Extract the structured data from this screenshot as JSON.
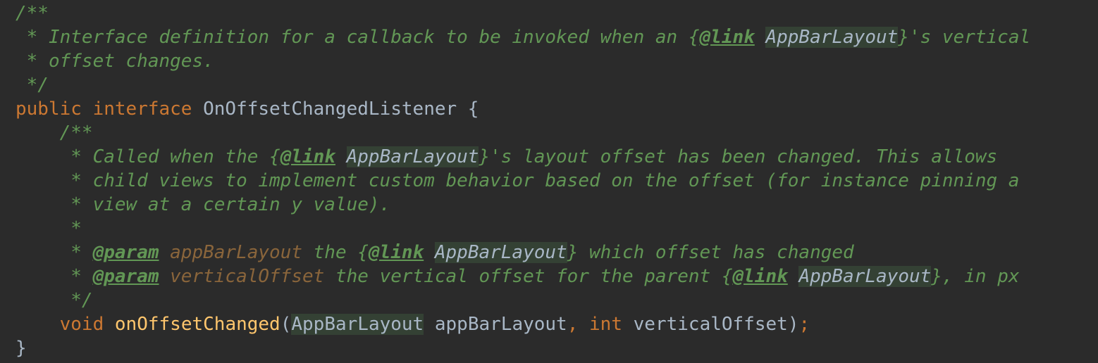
{
  "code": {
    "l1": {
      "text": "/**"
    },
    "l2": {
      "a": " * Interface definition for a callback to be invoked when an {",
      "tag": "@link",
      "sp": " ",
      "ref": "AppBarLayout",
      "b": "}'s vertical"
    },
    "l3": {
      "text": " * offset changes."
    },
    "l4": {
      "text": " */"
    },
    "l5": {
      "kw1": "public",
      "sp1": " ",
      "kw2": "interface",
      "sp2": " ",
      "name": "OnOffsetChangedListener",
      "brace": " {"
    },
    "l6": {
      "text": "    /**"
    },
    "l7": {
      "a": "     * Called when the {",
      "tag": "@link",
      "sp": " ",
      "ref": "AppBarLayout",
      "b": "}'s layout offset has been changed. This allows"
    },
    "l8": {
      "text": "     * child views to implement custom behavior based on the offset (for instance pinning a"
    },
    "l9": {
      "text": "     * view at a certain y value)."
    },
    "l10": {
      "text": "     *"
    },
    "l11": {
      "a": "     * ",
      "tag": "@param",
      "sp1": " ",
      "param": "appBarLayout",
      "b": " the {",
      "tag2": "@link",
      "sp2": " ",
      "ref": "AppBarLayout",
      "c": "} which offset has changed"
    },
    "l12": {
      "a": "     * ",
      "tag": "@param",
      "sp1": " ",
      "param": "verticalOffset",
      "b": " the vertical offset for the parent {",
      "tag2": "@link",
      "sp2": " ",
      "ref": "AppBarLayout",
      "c": "}, in px"
    },
    "l13": {
      "text": "     */"
    },
    "l14": {
      "indent": "    ",
      "kw1": "void",
      "sp1": " ",
      "method": "onOffsetChanged",
      "open": "(",
      "type1": "AppBarLayout",
      "arg1": " appBarLayout",
      "comma": ",",
      "sp2": " ",
      "kw2": "int",
      "arg2": " verticalOffset",
      "close": ")",
      "semi": ";"
    },
    "l15": {
      "text": "}"
    }
  },
  "colors": {
    "background": "#2b2b2b",
    "doc_comment": "#629755",
    "keyword": "#cc7832",
    "identifier": "#a9b7c6",
    "method_declaration": "#ffc66d",
    "param_name": "#8a653b",
    "reference_highlight": "#344134"
  }
}
